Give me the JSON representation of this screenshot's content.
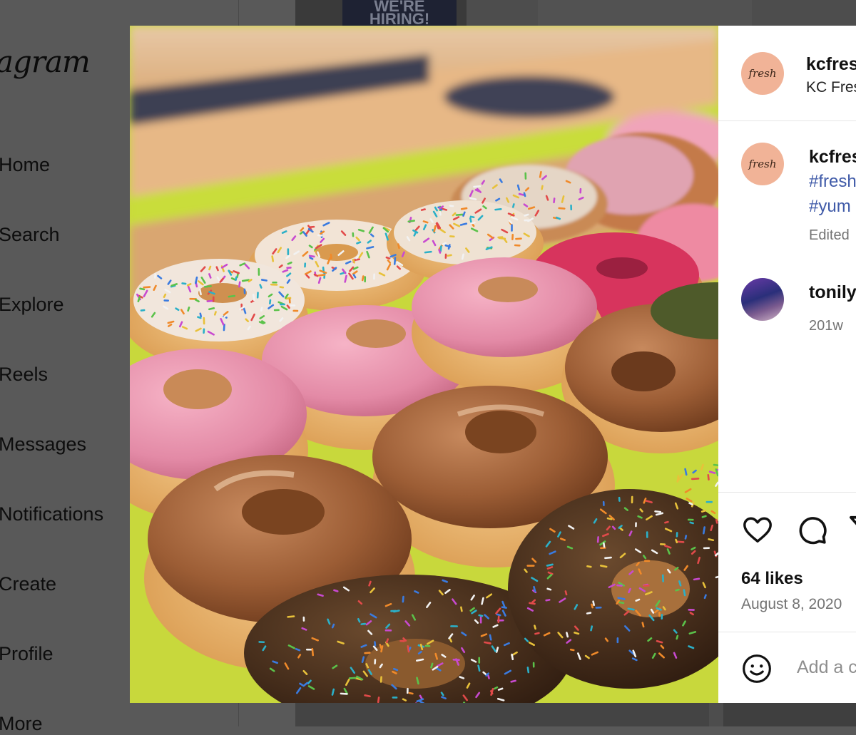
{
  "background": {
    "brand": "agram",
    "sign_text": "WE'RE HIRING!",
    "nav": [
      {
        "label": "Home"
      },
      {
        "label": "Search"
      },
      {
        "label": "Explore"
      },
      {
        "label": "Reels"
      },
      {
        "label": "Messages"
      },
      {
        "label": "Notifications"
      },
      {
        "label": "Create"
      },
      {
        "label": "Profile"
      },
      {
        "label": "More"
      }
    ]
  },
  "post": {
    "image_icon": "donuts-photo",
    "header": {
      "username": "kcfres",
      "display_name": "KC Fres",
      "avatar_text": "fresh"
    },
    "caption": {
      "username": "kcfres",
      "hashtag1": "#fresh",
      "hashtag2": "#yum",
      "edited": "Edited"
    },
    "comment": {
      "username": "tonily",
      "age": "201w"
    },
    "likes": "64 likes",
    "date": "August 8, 2020",
    "add_comment_placeholder": "Add a c",
    "colors": {
      "avatar_bg": "#f1b397",
      "hashtag": "#3f5aa8",
      "secondary_text": "#737373",
      "overlay": "#595959"
    }
  }
}
